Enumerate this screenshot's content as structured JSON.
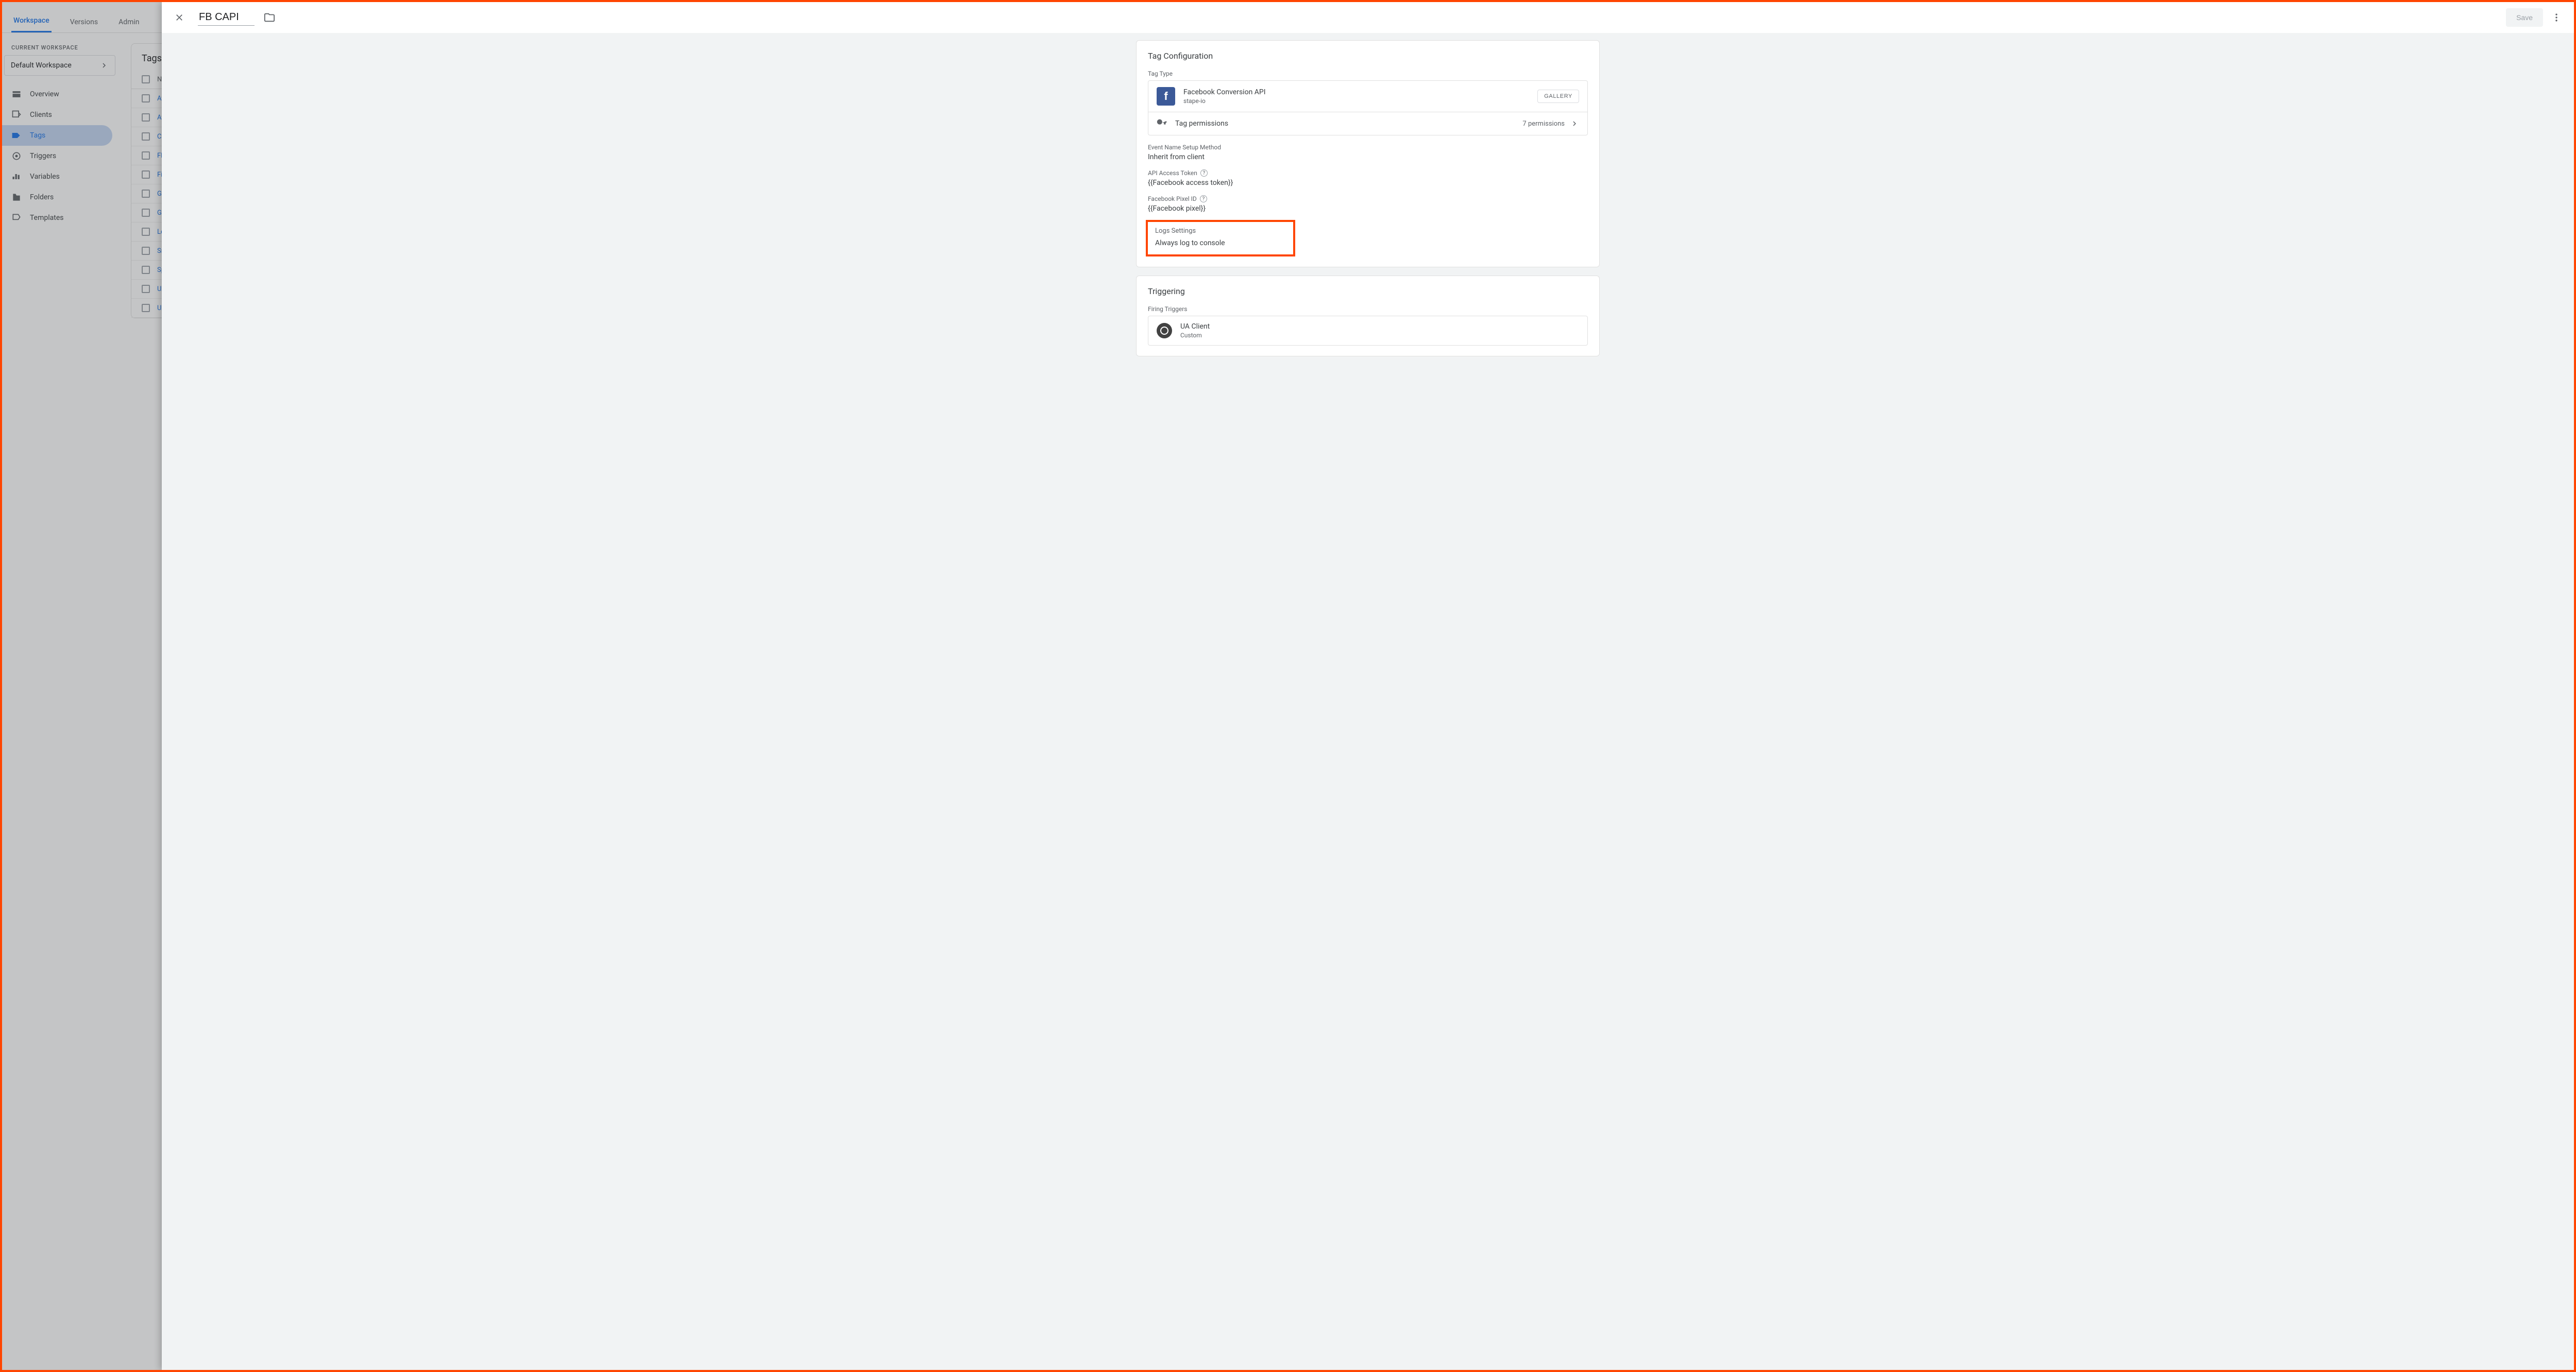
{
  "header_tabs": {
    "workspace": "Workspace",
    "versions": "Versions",
    "admin": "Admin"
  },
  "workspace": {
    "label": "CURRENT WORKSPACE",
    "name": "Default Workspace"
  },
  "nav": {
    "overview": "Overview",
    "clients": "Clients",
    "tags": "Tags",
    "triggers": "Triggers",
    "variables": "Variables",
    "folders": "Folders",
    "templates": "Templates"
  },
  "tags_panel": {
    "title": "Tags",
    "name_col": "Name",
    "rows": [
      "Aw",
      "Aw",
      "Co",
      "FB",
      "Fir",
      "GA",
      "Go",
      "Lo",
      "Sn",
      "Sp",
      "UA",
      "UA"
    ]
  },
  "panel": {
    "name": "FB CAPI",
    "save": "Save"
  },
  "tag_config": {
    "title": "Tag Configuration",
    "tag_type_label": "Tag Type",
    "tag_type_name": "Facebook Conversion API",
    "tag_type_vendor": "stape-io",
    "gallery": "GALLERY",
    "permissions_label": "Tag permissions",
    "permissions_count": "7 permissions",
    "event_method_label": "Event Name Setup Method",
    "event_method_value": "Inherit from client",
    "token_label": "API Access Token",
    "token_value": "{{Facebook access token}}",
    "pixel_label": "Facebook Pixel ID",
    "pixel_value": "{{Facebook pixel}}",
    "logs_label": "Logs Settings",
    "logs_value": "Always log to console"
  },
  "triggering": {
    "title": "Triggering",
    "firing_label": "Firing Triggers",
    "trigger_name": "UA Client",
    "trigger_type": "Custom"
  }
}
